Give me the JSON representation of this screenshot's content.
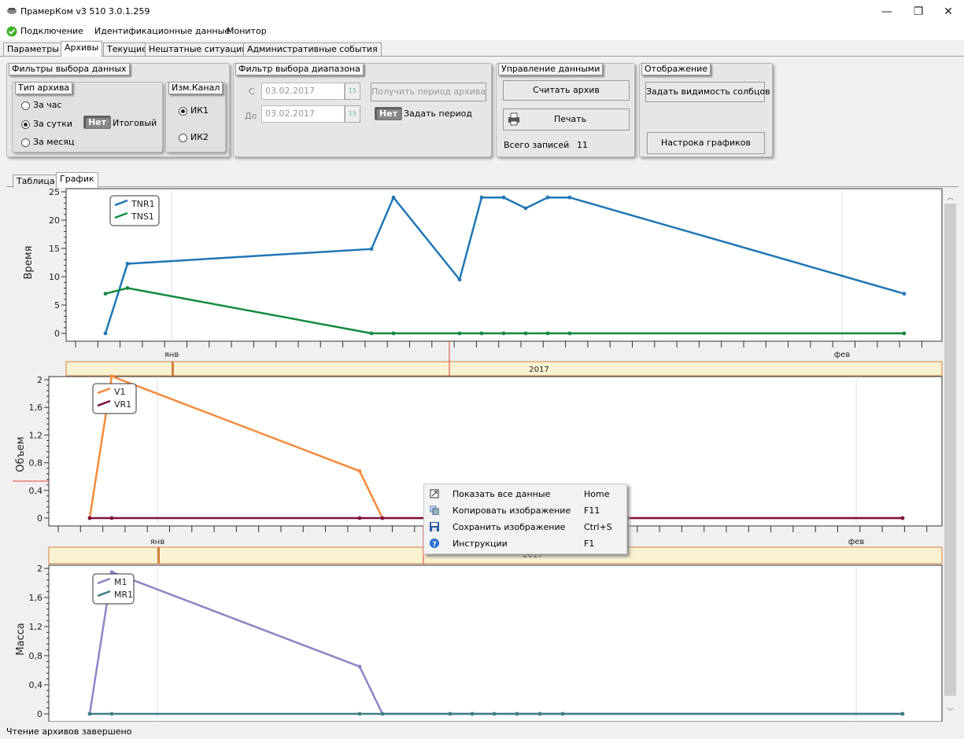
{
  "window": {
    "title": "ПрамерКом v3 510 3.0.1.259"
  },
  "menu": [
    "Подключение",
    "Идентификационные данные",
    "Монитор"
  ],
  "tabs": [
    "Параметры",
    "Архивы",
    "Текущие",
    "Нештатные ситуации",
    "Административные события"
  ],
  "active_tab": "Архивы",
  "filters": {
    "title": "Фильтры выбора данных",
    "archive_type": {
      "title": "Тип архива",
      "options": [
        "За час",
        "За сутки",
        "За месяц"
      ],
      "selected": "За сутки"
    },
    "total_toggle": {
      "state": "Нет",
      "label": "Итоговый"
    },
    "channel": {
      "title": "Изм.Канал",
      "options": [
        "ИК1",
        "ИК2"
      ],
      "selected": "ИК1"
    }
  },
  "range": {
    "title": "Фильтр выбора диапазона",
    "from_label": "С",
    "from_value": "03.02.2017",
    "to_label": "До",
    "to_value": "03.02.2017",
    "get_period_label": "Получить период архива",
    "period_toggle": {
      "state": "Нет",
      "label": "Задать период"
    },
    "cal_label": "15"
  },
  "data_mgmt": {
    "title": "Управление данными",
    "read_label": "Считать архив",
    "print_label": "Печать",
    "total_records_label": "Всего записей",
    "total_records_value": "11"
  },
  "display": {
    "title": "Отображение",
    "visibility_label": "Задать видимость солбцов",
    "chart_settings_label": "Настрока графиков"
  },
  "subtabs": [
    "Таблица",
    "График"
  ],
  "active_subtab": "График",
  "context_menu": {
    "items": [
      {
        "icon": "zoom-extents-icon",
        "label": "Показать все данные",
        "shortcut": "Home"
      },
      {
        "icon": "copy-image-icon",
        "label": "Копировать изображение",
        "shortcut": "F11"
      },
      {
        "icon": "save-icon",
        "label": "Сохранить изображение",
        "shortcut": "Ctrl+S"
      },
      {
        "icon": "help-icon",
        "label": "Инструкции",
        "shortcut": "F1"
      }
    ]
  },
  "status": {
    "text": "Чтение архивов завершено"
  },
  "colors": {
    "blue": "#1f77b4",
    "green": "#138a3f",
    "orange": "#f58a3c",
    "maroon": "#7b1040",
    "purple": "#8c86c7",
    "teal": "#3f7f86",
    "timeline": "#faf3d2",
    "timeline_border": "#d08040"
  },
  "chart_data": [
    {
      "type": "line",
      "ylabel": "Время",
      "ylim": [
        0,
        25
      ],
      "yticks": [
        0,
        5,
        10,
        15,
        20,
        25
      ],
      "ytick_labels": [
        "0",
        "5",
        "10",
        "15",
        "20",
        "25"
      ],
      "x_tick_labels": [
        "янв",
        "фев"
      ],
      "year_label": "2017",
      "legend": "top-left",
      "series": [
        {
          "name": "TNR1",
          "color": "#1f77b4",
          "x": [
            0,
            1,
            12,
            13,
            16,
            17,
            18,
            19,
            20,
            21,
            36
          ],
          "y": [
            0,
            12.3,
            14.9,
            24,
            9.5,
            24,
            24,
            22.1,
            24,
            24,
            7
          ]
        },
        {
          "name": "TNS1",
          "color": "#138a3f",
          "x": [
            0,
            1,
            12,
            13,
            16,
            17,
            18,
            19,
            20,
            21,
            36
          ],
          "y": [
            7,
            8,
            0,
            0,
            0,
            0,
            0,
            0,
            0,
            0,
            0
          ]
        }
      ]
    },
    {
      "type": "line",
      "ylabel": "Объем",
      "ylim": [
        0,
        2
      ],
      "yticks": [
        0,
        0.4,
        0.8,
        1.2,
        1.6,
        2
      ],
      "ytick_labels": [
        "0",
        "0,4",
        "0,8",
        "1,2",
        "1,6",
        "2"
      ],
      "x_tick_labels": [
        "янв",
        "фев"
      ],
      "year_label": "2017",
      "legend": "top-left",
      "series": [
        {
          "name": "V1",
          "color": "#f58a3c",
          "x": [
            0,
            1,
            12,
            13,
            16,
            17,
            18,
            19,
            20,
            21,
            36
          ],
          "y": [
            0,
            2.05,
            0.68,
            0,
            0,
            0,
            0,
            0,
            0,
            0,
            0
          ]
        },
        {
          "name": "VR1",
          "color": "#7b1040",
          "x": [
            0,
            1,
            12,
            13,
            16,
            17,
            18,
            19,
            20,
            21,
            36
          ],
          "y": [
            0,
            0,
            0,
            0,
            0,
            0,
            0,
            0,
            0,
            0,
            0
          ]
        }
      ]
    },
    {
      "type": "line",
      "ylabel": "Масса",
      "ylim": [
        0,
        2
      ],
      "yticks": [
        0,
        0.4,
        0.8,
        1.2,
        1.6,
        2
      ],
      "ytick_labels": [
        "0",
        "0,4",
        "0,8",
        "1,2",
        "1,6",
        "2"
      ],
      "x_tick_labels": [],
      "year_label": "",
      "legend": "top-left",
      "series": [
        {
          "name": "M1",
          "color": "#8c86c7",
          "x": [
            0,
            1,
            12,
            13,
            16,
            17,
            18,
            19,
            20,
            21,
            36
          ],
          "y": [
            0,
            1.95,
            0.65,
            0,
            0,
            0,
            0,
            0,
            0,
            0,
            0
          ]
        },
        {
          "name": "MR1",
          "color": "#3f7f86",
          "x": [
            0,
            1,
            12,
            13,
            16,
            17,
            18,
            19,
            20,
            21,
            36
          ],
          "y": [
            0,
            0,
            0,
            0,
            0,
            0,
            0,
            0,
            0,
            0,
            0
          ]
        }
      ]
    }
  ]
}
